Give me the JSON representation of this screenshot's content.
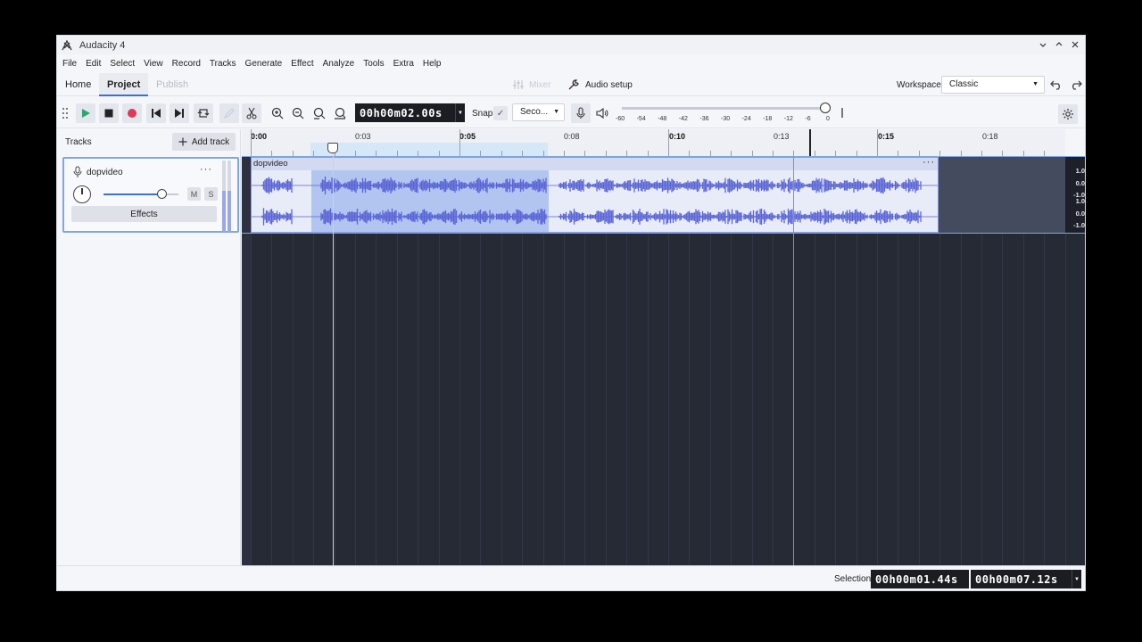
{
  "window": {
    "title": "Audacity 4"
  },
  "menu": [
    "File",
    "Edit",
    "Select",
    "View",
    "Record",
    "Tracks",
    "Generate",
    "Effect",
    "Analyze",
    "Tools",
    "Extra",
    "Help"
  ],
  "nav": {
    "tabs": [
      "Home",
      "Project",
      "Publish"
    ],
    "active_tab": "Project",
    "mixer_label": "Mixer",
    "audio_setup_label": "Audio setup",
    "workspace_label": "Workspace",
    "workspace_value": "Classic"
  },
  "toolbar": {
    "time": "00h00m02.00s",
    "snap_label": "Snap",
    "snap_unit": "Seco...",
    "meter_ticks": [
      "-60",
      "-54",
      "-48",
      "-42",
      "-36",
      "-30",
      "-24",
      "-18",
      "-12",
      "-6",
      "0"
    ]
  },
  "tracks_panel": {
    "label": "Tracks",
    "add_track_label": "Add track",
    "track": {
      "name": "dopvideo",
      "mute_label": "M",
      "solo_label": "S",
      "effects_label": "Effects"
    }
  },
  "ruler": {
    "labels": [
      "0:00",
      "0:03",
      "0:05",
      "0:08",
      "0:10",
      "0:13",
      "0:15",
      "0:18"
    ],
    "major": [
      "0:00",
      "0:05",
      "0:10",
      "0:15"
    ]
  },
  "clip": {
    "name": "dopvideo"
  },
  "amplitude_labels": [
    "1.0",
    "0.0",
    "-1.0",
    "1.0",
    "0.0",
    "-1.0"
  ],
  "status": {
    "selection_label": "Selection",
    "selection_start": "00h00m01.44s",
    "selection_end": "00h00m07.12s"
  },
  "colors": {
    "accent": "#3e6fd8",
    "waveform": "#5a64d6",
    "selection": "#b1c5f0",
    "record": "#e2365a",
    "play": "#2ea66f",
    "timeline_bg": "#262a35"
  }
}
